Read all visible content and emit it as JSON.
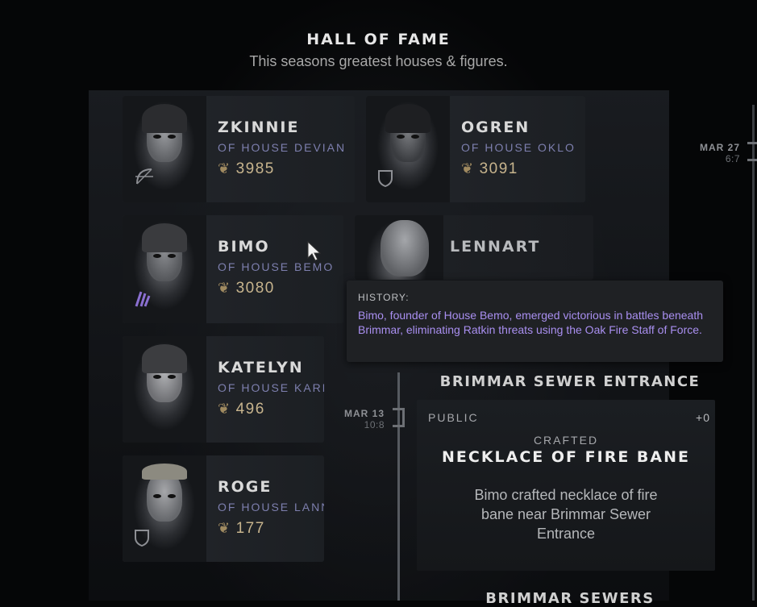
{
  "header": {
    "title": "HALL OF FAME",
    "subtitle": "This seasons greatest houses & figures."
  },
  "figures": [
    {
      "name": "ZKINNIE",
      "house": "OF HOUSE DEVIAN",
      "score": "3985",
      "house_icon": "bow-icon"
    },
    {
      "name": "OGREN",
      "house": "OF HOUSE OKLO",
      "score": "3091",
      "house_icon": "shield-icon"
    },
    {
      "name": "BIMO",
      "house": "OF HOUSE BEMO",
      "score": "3080",
      "house_icon": "claw-icon"
    },
    {
      "name": "LENNART",
      "house": "",
      "score": "",
      "house_icon": ""
    },
    {
      "name": "KATELYN",
      "house": "OF HOUSE KARD",
      "score": "496",
      "house_icon": ""
    },
    {
      "name": "ROGE",
      "house": "OF HOUSE LANN",
      "score": "177",
      "house_icon": "shield-icon"
    }
  ],
  "tooltip": {
    "label": "HISTORY:",
    "body": "Bimo, founder of House Bemo, emerged victorious in battles beneath Brimmar, eliminating Ratkin threats using the Oak Fire Staff of Force."
  },
  "timeline": {
    "right_entry": {
      "date": "MAR 27",
      "time": "6:7"
    },
    "left_entry": {
      "date": "MAR 13",
      "time": "10:8"
    },
    "event": {
      "location": "BRIMMAR SEWER ENTRANCE",
      "visibility": "PUBLIC",
      "delta": "+0",
      "action": "CRAFTED",
      "item": "NECKLACE OF FIRE BANE",
      "description": "Bimo crafted necklace of fire bane near Brimmar Sewer Entrance"
    },
    "next_location": "BRIMMAR SEWERS"
  },
  "colors": {
    "house_text": "#7d7fae",
    "score_text": "#c7b48d",
    "tooltip_text": "#a98ff0"
  }
}
